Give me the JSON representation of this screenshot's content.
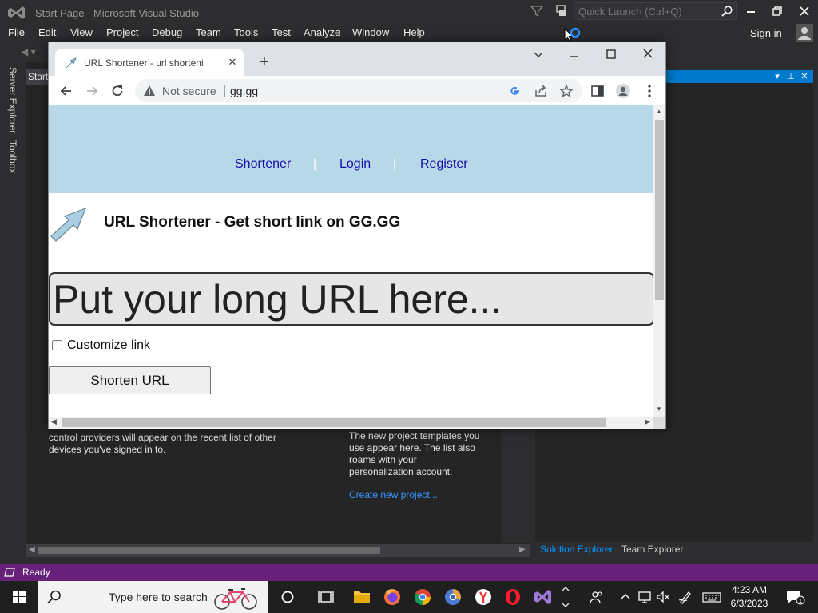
{
  "vs": {
    "title": "Start Page - Microsoft Visual Studio",
    "quick_launch_placeholder": "Quick Launch (Ctrl+Q)",
    "menu": [
      "File",
      "Edit",
      "View",
      "Project",
      "Debug",
      "Team",
      "Tools",
      "Test",
      "Analyze",
      "Window",
      "Help"
    ],
    "sign_in": "Sign in",
    "side_tabs": [
      "Server Explorer",
      "Toolbox"
    ],
    "doc_tab": "Start",
    "doc_left_text": [
      "control providers will appear on the recent list of other",
      "devices you've signed in to."
    ],
    "doc_right_text": [
      "The new project templates you",
      "use appear here. The list also",
      "roams with your",
      "personalization account."
    ],
    "doc_link": "Create new project...",
    "right_tabs": [
      "Solution Explorer",
      "Team Explorer"
    ],
    "status": "Ready",
    "accent_color": "#68217a",
    "link_color": "#3794ff"
  },
  "chrome": {
    "tab_title": "URL Shortener - url shortening se",
    "not_secure": "Not secure",
    "url": "gg.gg"
  },
  "site": {
    "nav": [
      "Shortener",
      "Login",
      "Register"
    ],
    "nav_separator": "|",
    "heading": "URL Shortener - Get short link on GG.GG",
    "input_placeholder": "Put your long URL here...",
    "customize_label": "Customize link",
    "shorten_button": "Shorten URL",
    "header_color": "#b7d8e6",
    "nav_link_color": "#1a0dab"
  },
  "taskbar": {
    "search_placeholder": "Type here to search",
    "time": "4:23 AM",
    "date": "6/3/2023"
  }
}
